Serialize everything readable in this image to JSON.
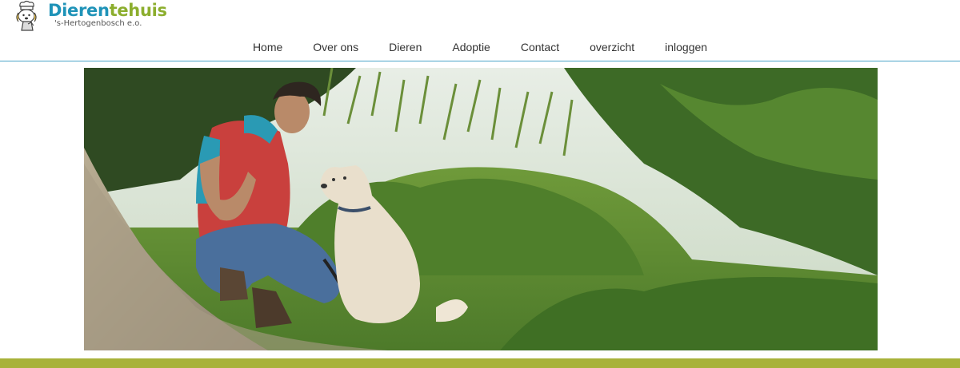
{
  "logo": {
    "title_part1": "Dieren",
    "title_part2": "tehuis",
    "subtitle": "'s-Hertogenbosch e.o."
  },
  "nav": {
    "items": [
      {
        "label": "Home"
      },
      {
        "label": "Over ons"
      },
      {
        "label": "Dieren"
      },
      {
        "label": "Adoptie"
      },
      {
        "label": "Contact"
      },
      {
        "label": "overzicht"
      },
      {
        "label": "inloggen"
      }
    ]
  },
  "colors": {
    "brand_blue": "#1f93b8",
    "brand_green": "#8cae2e",
    "header_border": "#4aa3c8",
    "footer_bar": "#a8b23a"
  },
  "icons": {
    "logo": "animal-shelter-logo-icon"
  }
}
